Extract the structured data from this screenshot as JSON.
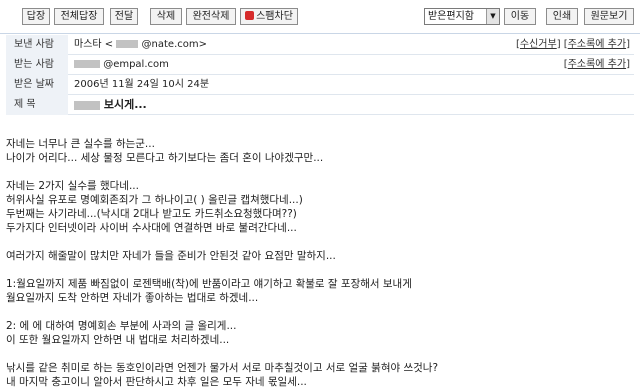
{
  "toolbar": {
    "reply_all": "전체답장",
    "reply": "답장",
    "forward": "전달",
    "delete": "삭제",
    "delete_perm": "완전삭제",
    "spam_block": "스팸차단",
    "folder_select": "받은편지함",
    "move": "이동",
    "print": "인쇄",
    "view_source": "원문보기"
  },
  "header": {
    "from_label": "보낸 사람",
    "from_value_prefix": "마스타 <",
    "from_value_domain": "@nate.com>",
    "from_links": [
      "수신거부",
      "주소록에 추가"
    ],
    "to_label": "받는 사람",
    "to_value_domain": "@empal.com",
    "to_links": [
      "주소록에 추가"
    ],
    "date_label": "받은 날짜",
    "date_value": "2006년 11월 24일 10시 24분",
    "subject_label": "제 목",
    "subject_value": "보시게..."
  },
  "body": {
    "lines": [
      "자네는 너무나 큰 실수를 하는군...",
      "나이가 어리다... 세상 물정 모른다고 하기보다는 좀더 혼이 나야겠구만...",
      "",
      "자네는 2가지 실수를 했다네...",
      "허위사실 유포로 명예회존죄가 그 하나이고(  ) 올린글 캡쳐했다네...)",
      "두번째는 사기라네...(낙시대 2대나 받고도 카드취소요청했다며??)",
      "두가지다 인터넷이라 사이버 수사대에 연결하면 바로 불려간다네...",
      "",
      "여러가지 해줄말이 많치만 자네가 들을 준비가 안된것 같아 요점만 말하지...",
      "",
      "1:월요일까지 제품 빠짐없이 로젠택배(착)에 반품이라고 얘기하고 확불로 잘 포장해서 보내게",
      "  월요일까지 도착 안하면 자네가 좋아하는 법대로 하겠네...",
      "",
      "2:   에     에 대하여 명예회손 부분에 사과의 글 올리게...",
      "   이 또한 월요일까지 안하면  내 법대로 처리하겠네...",
      "",
      "낚시를 같은 취미로 하는 동호인이라면 언젠가 물가서 서로 마추칠것이고 서로 얼굴 붉혀야 쓰것나?",
      "내 마지막 충고이니 알아서 판단하시고 차후 일은 모두 자네 몫일세..."
    ]
  },
  "colors": {
    "label_bg": "#eef2f7",
    "spam_icon": "#d62b2b",
    "toolbar_border": "#c9d6e6"
  },
  "icons": {
    "spam": "stop-icon",
    "select_arrow": "chevron-down-icon"
  }
}
